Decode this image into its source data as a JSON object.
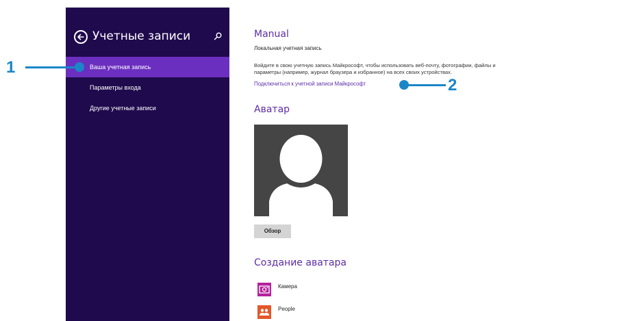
{
  "nav": {
    "title": "Учетные записи",
    "items": [
      {
        "label": "Ваша учетная запись",
        "active": true
      },
      {
        "label": "Параметры входа",
        "active": false
      },
      {
        "label": "Другие учетные записи",
        "active": false
      }
    ]
  },
  "account": {
    "name": "Manual",
    "type": "Локальная учетная запись",
    "description": "Войдите в свою учетную запись Майкрософт, чтобы использовать веб-почту, фотографии, файлы и параметры (например, журнал браузера и избранное) на всех своих устройствах.",
    "connect_link": "Подключиться к учетной записи Майкрософт"
  },
  "avatar": {
    "title": "Аватар",
    "browse_label": "Обзор"
  },
  "create_avatar": {
    "title": "Создание аватара",
    "apps": [
      {
        "label": "Камера",
        "icon": "camera-icon",
        "color": "#b4219c"
      },
      {
        "label": "People",
        "icon": "people-icon",
        "color": "#e2572b"
      }
    ]
  },
  "callouts": {
    "first": "1",
    "second": "2"
  },
  "colors": {
    "nav_background": "#1f0a4d",
    "nav_active": "#6b2fbf",
    "accent_text": "#5d2ba8",
    "callout": "#1a86c8"
  }
}
